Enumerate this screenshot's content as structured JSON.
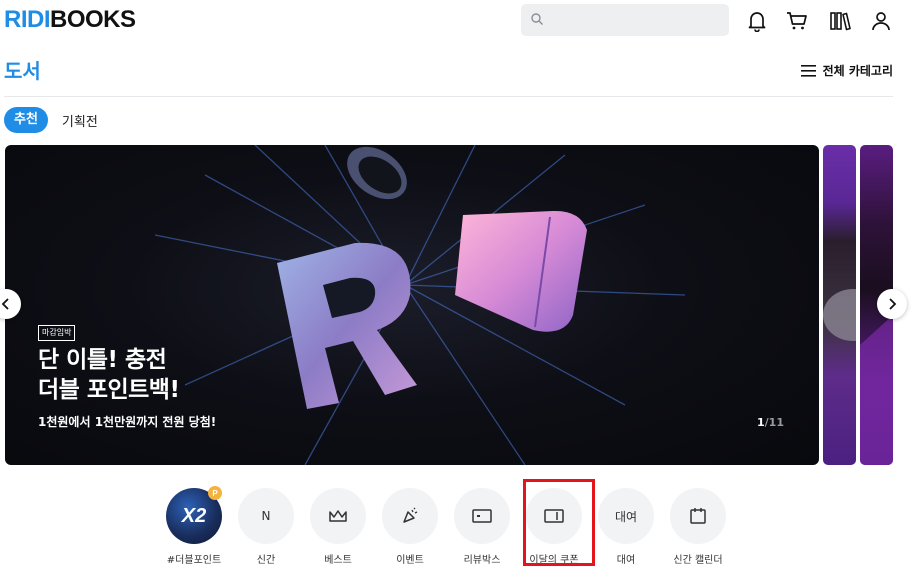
{
  "header": {
    "logo_part1": "RIDI",
    "logo_part2": "BOOKS",
    "search_placeholder": "",
    "icons": [
      "bell-icon",
      "cart-icon",
      "library-icon",
      "user-icon"
    ]
  },
  "section": {
    "title": "도서",
    "all_categories": "전체 카테고리"
  },
  "tabs": [
    {
      "label": "추천",
      "active": true
    },
    {
      "label": "기획전",
      "active": false
    }
  ],
  "banner": {
    "tag": "마감임박",
    "headline_line1": "단 이틀! 충전",
    "headline_line2": "더블 포인트백!",
    "subline": "1천원에서 1천만원까지 전원 당첨!",
    "pager_current": "1",
    "pager_total": "/11"
  },
  "quick_menu": [
    {
      "label": "#더블포인트",
      "icon": "x2-badge-icon",
      "icon_text": "X2",
      "badge": "P"
    },
    {
      "label": "신간",
      "icon": "n-letter-icon",
      "icon_text": "N"
    },
    {
      "label": "베스트",
      "icon": "crown-icon"
    },
    {
      "label": "이벤트",
      "icon": "party-popper-icon"
    },
    {
      "label": "리뷰박스",
      "icon": "ticket-icon"
    },
    {
      "label": "이달의 쿠폰",
      "icon": "coupon-icon"
    },
    {
      "label": "대여",
      "icon": "rent-text-icon",
      "icon_text": "대여"
    },
    {
      "label": "신간 캘린더",
      "icon": "calendar-icon"
    }
  ],
  "colors": {
    "brand": "#1f8ce6",
    "highlight": "#e4141b"
  }
}
